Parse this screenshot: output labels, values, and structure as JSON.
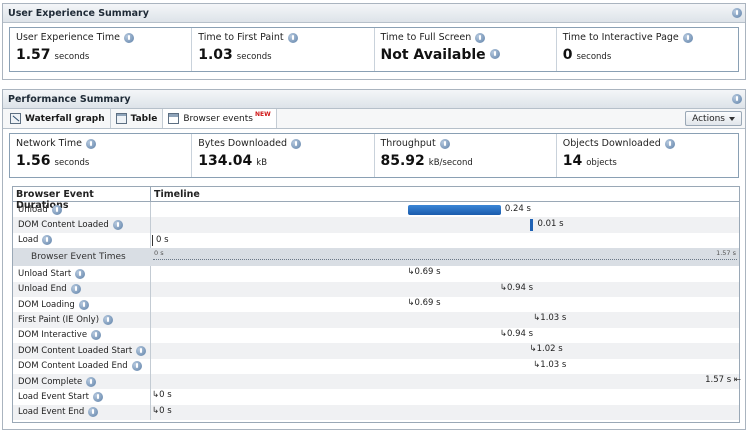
{
  "ux_summary": {
    "title": "User Experience Summary",
    "metrics": [
      {
        "label": "User Experience Time",
        "value": "1.57",
        "unit": "seconds"
      },
      {
        "label": "Time to First Paint",
        "value": "1.03",
        "unit": "seconds"
      },
      {
        "label": "Time to Full Screen",
        "value": "Not Available",
        "unit": ""
      },
      {
        "label": "Time to Interactive Page",
        "value": "0",
        "unit": "seconds"
      }
    ]
  },
  "perf_summary": {
    "title": "Performance Summary",
    "tabs": [
      {
        "label": "Waterfall graph",
        "icon": "waterfall-icon"
      },
      {
        "label": "Table",
        "icon": "table-icon"
      },
      {
        "label": "Browser events",
        "icon": "browser-events-icon",
        "badge": "NEW"
      }
    ],
    "actions_label": "Actions",
    "metrics": [
      {
        "label": "Network Time",
        "value": "1.56",
        "unit": "seconds"
      },
      {
        "label": "Bytes Downloaded",
        "value": "134.04",
        "unit": "kB"
      },
      {
        "label": "Throughput",
        "value": "85.92",
        "unit": "kB/second"
      },
      {
        "label": "Objects Downloaded",
        "value": "14",
        "unit": "objects"
      }
    ]
  },
  "grid": {
    "col1_header": "Browser Event Durations",
    "col2_header": "Timeline",
    "axis_max_s": 1.57,
    "durations": [
      {
        "label": "Unload",
        "start": 0.69,
        "end": 0.94,
        "value_label": "0.24 s"
      },
      {
        "label": "DOM Content Loaded",
        "start": 1.02,
        "end": 1.03,
        "value_label": "0.01 s"
      },
      {
        "label": "Load",
        "start": 0,
        "end": 0,
        "value_label": "0 s"
      }
    ],
    "section_label": "Browser Event Times",
    "axis_start_label": "0 s",
    "axis_end_label": "1.57 s",
    "times": [
      {
        "label": "Unload Start",
        "t": 0.69,
        "value_label": "0.69 s"
      },
      {
        "label": "Unload End",
        "t": 0.94,
        "value_label": "0.94 s"
      },
      {
        "label": "DOM Loading",
        "t": 0.69,
        "value_label": "0.69 s"
      },
      {
        "label": "First Paint (IE Only)",
        "t": 1.03,
        "value_label": "1.03 s"
      },
      {
        "label": "DOM Interactive",
        "t": 0.94,
        "value_label": "0.94 s"
      },
      {
        "label": "DOM Content Loaded Start",
        "t": 1.02,
        "value_label": "1.02 s"
      },
      {
        "label": "DOM Content Loaded End",
        "t": 1.03,
        "value_label": "1.03 s"
      },
      {
        "label": "DOM Complete",
        "t": 1.57,
        "value_label": "1.57 s"
      },
      {
        "label": "Load Event Start",
        "t": 0,
        "value_label": "0 s"
      },
      {
        "label": "Load Event End",
        "t": 0,
        "value_label": "0 s"
      }
    ]
  }
}
